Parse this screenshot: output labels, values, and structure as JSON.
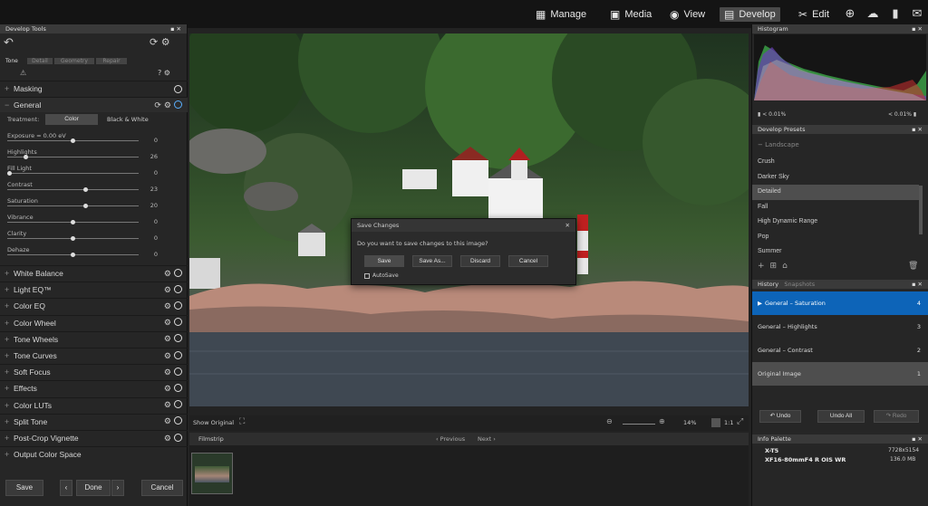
{
  "colors": {
    "accent_blue": "#0d64b8",
    "active_mode": "#4a4a4a"
  },
  "modes": [
    {
      "label": "Manage",
      "icon": "grid-icon"
    },
    {
      "label": "Media",
      "icon": "media-icon"
    },
    {
      "label": "View",
      "icon": "eye-icon"
    },
    {
      "label": "Develop",
      "icon": "develop-icon"
    },
    {
      "label": "Edit",
      "icon": "edit-icon"
    }
  ],
  "left": {
    "header": "Develop Tools",
    "tabs": [
      "Tone",
      "Detail",
      "Geometry",
      "Repair"
    ],
    "masking": "Masking",
    "general": "General",
    "treatment_label": "Treatment:",
    "treatment_options": [
      "Color",
      "Black & White"
    ],
    "sliders": [
      {
        "label": "Exposure = 0.00 eV",
        "value": "0",
        "pos": 0.5
      },
      {
        "label": "Highlights",
        "value": "26",
        "pos": 0.13
      },
      {
        "label": "Fill Light",
        "value": "0",
        "pos": 0.0
      },
      {
        "label": "Contrast",
        "value": "23",
        "pos": 0.6
      },
      {
        "label": "Saturation",
        "value": "20",
        "pos": 0.6
      },
      {
        "label": "Vibrance",
        "value": "0",
        "pos": 0.5
      },
      {
        "label": "Clarity",
        "value": "0",
        "pos": 0.5
      },
      {
        "label": "Dehaze",
        "value": "0",
        "pos": 0.5
      }
    ],
    "sections": [
      "White Balance",
      "Light EQ™",
      "Color EQ",
      "Color Wheel",
      "Tone Wheels",
      "Tone Curves",
      "Soft Focus",
      "Effects",
      "Color LUTs",
      "Split Tone",
      "Post-Crop Vignette",
      "Output Color Space"
    ],
    "buttons": {
      "save": "Save",
      "done": "Done",
      "cancel": "Cancel"
    }
  },
  "viewer": {
    "show_original": "Show Original",
    "zoom": "14%",
    "ratio": "1:1"
  },
  "filmstrip": {
    "label": "Filmstrip",
    "previous": "Previous",
    "next": "Next"
  },
  "dialog": {
    "title": "Save Changes",
    "message": "Do you want to save changes to this image?",
    "buttons": [
      "Save",
      "Save As...",
      "Discard",
      "Cancel"
    ],
    "autosave": "AutoSave"
  },
  "right": {
    "histogram": "Histogram",
    "clip_low": "< 0.01%",
    "clip_high": "< 0.01%",
    "presets_header": "Develop Presets",
    "presets_group": "Landscape",
    "presets": [
      "Crush",
      "Darker Sky",
      "Detailed",
      "Fall",
      "High Dynamic Range",
      "Pop",
      "Summer"
    ],
    "selected_preset": "Detailed",
    "history_tabs": [
      "History",
      "Snapshots"
    ],
    "history": [
      {
        "label": "General – Saturation",
        "n": "4"
      },
      {
        "label": "General – Highlights",
        "n": "3"
      },
      {
        "label": "General – Contrast",
        "n": "2"
      },
      {
        "label": "Original Image",
        "n": "1"
      }
    ],
    "undo": "Undo",
    "undo_all": "Undo All",
    "redo": "Redo",
    "info_header": "Info Palette",
    "camera": "X-T5",
    "lens": "XF16-80mmF4 R OIS WR",
    "dims": "7728x5154",
    "size": "136.0 MB"
  }
}
